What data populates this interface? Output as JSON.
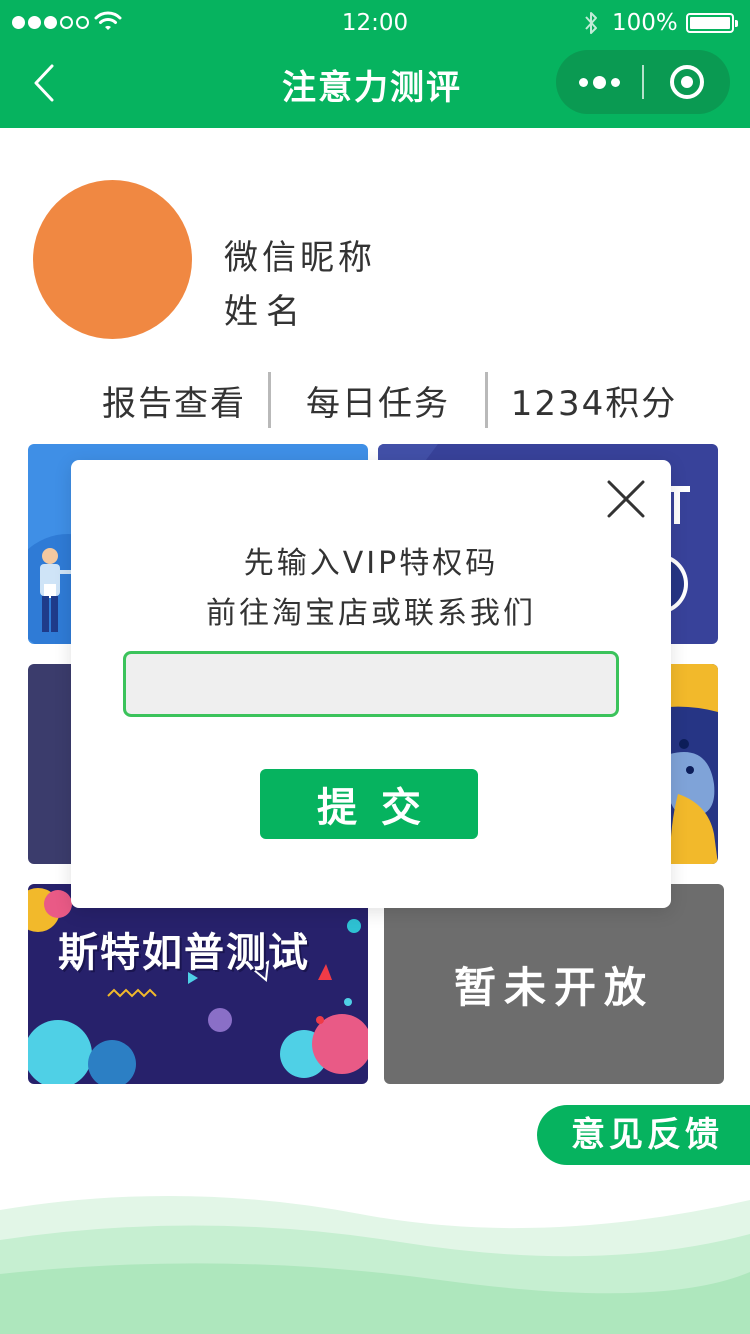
{
  "status_bar": {
    "time": "12:00",
    "battery": "100%",
    "signal_icon": "signal-dots-icon",
    "wifi_icon": "wifi-icon",
    "bluetooth_icon": "bluetooth-icon"
  },
  "nav": {
    "title": "注意力测评",
    "back_icon": "chevron-left-icon",
    "more_icon": "more-dots-icon",
    "close_icon": "target-circle-icon"
  },
  "profile": {
    "nickname": "微信昵称",
    "name": "姓名",
    "avatar_color": "#f08842"
  },
  "stats": {
    "report": "报告查看",
    "daily_task": "每日任务",
    "points": "1234积分"
  },
  "cards": {
    "stroop": "斯特如普测试",
    "coming_soon": "暂未开放"
  },
  "feedback_label": "意见反馈",
  "modal": {
    "line1": "先输入VIP特权码",
    "line2": "前往淘宝店或联系我们",
    "input_value": "",
    "input_placeholder": "",
    "submit_label": "提交"
  },
  "colors": {
    "brand_green": "#06b35f",
    "input_border": "#3bc35b",
    "coming_soon_bg": "#6d6d6d"
  }
}
